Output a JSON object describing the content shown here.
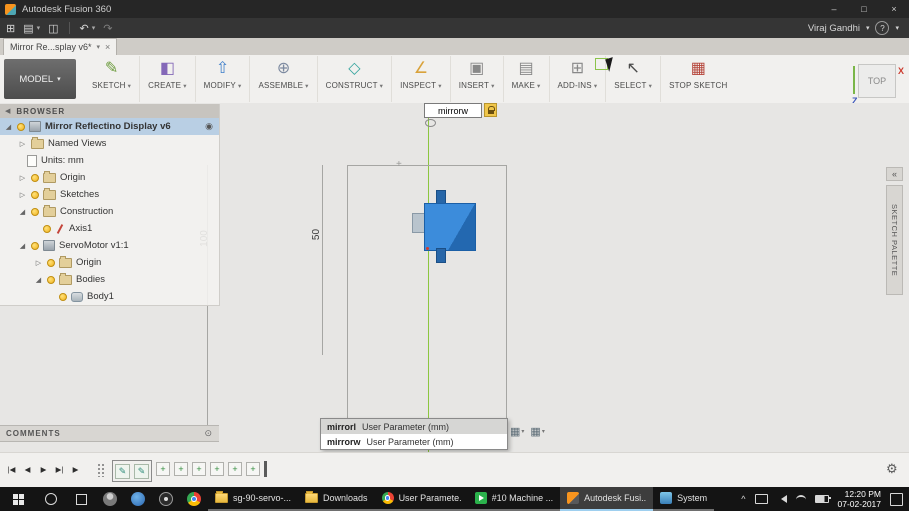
{
  "window": {
    "title": "Autodesk Fusion 360"
  },
  "appbar": {
    "user": "Viraj Gandhi"
  },
  "tab": {
    "label": "Mirror Re...splay v6*"
  },
  "icons": {
    "menu_grid": "⊞",
    "file": "▤",
    "save": "◫",
    "undo": "↶",
    "redo": "↷",
    "caret": "▾",
    "help": "?",
    "min": "–",
    "max": "□",
    "close": "×",
    "tri_open": "◢",
    "tri_closed": "▷",
    "radio": "◉",
    "target": "⊙",
    "collapse_left": "◀",
    "gear": "⚙",
    "grid_snap": "▦",
    "pencil": "✎",
    "plus": "+",
    "cross": "+",
    "caret_up": "^"
  },
  "ribbon": {
    "model": {
      "label": "MODEL"
    },
    "items": [
      {
        "label": "SKETCH",
        "glyph": "✎"
      },
      {
        "label": "CREATE",
        "glyph": "◧"
      },
      {
        "label": "MODIFY",
        "glyph": "⇧"
      },
      {
        "label": "ASSEMBLE",
        "glyph": "⊕"
      },
      {
        "label": "CONSTRUCT",
        "glyph": "◇"
      },
      {
        "label": "INSPECT",
        "glyph": "∠"
      },
      {
        "label": "INSERT",
        "glyph": "▣"
      },
      {
        "label": "MAKE",
        "glyph": "▤"
      },
      {
        "label": "ADD-INS",
        "glyph": "⊞"
      },
      {
        "label": "SELECT",
        "glyph": "↖"
      },
      {
        "label": "STOP SKETCH",
        "glyph": "▦"
      }
    ]
  },
  "viewcube": {
    "face": "TOP",
    "axis_x": "X",
    "axis_z": "Z"
  },
  "browser": {
    "header": "BROWSER",
    "items": [
      {
        "label": "Mirror Reflectino Display v6"
      },
      {
        "label": "Named Views"
      },
      {
        "label": "Units: mm"
      },
      {
        "label": "Origin"
      },
      {
        "label": "Sketches"
      },
      {
        "label": "Construction"
      },
      {
        "label": "Axis1"
      },
      {
        "label": "ServoMotor v1:1"
      },
      {
        "label": "Origin"
      },
      {
        "label": "Bodies"
      },
      {
        "label": "Body1"
      }
    ]
  },
  "canvas": {
    "dim_input_value": "mirrorw",
    "dimensions": {
      "d100": "100",
      "d50": "50"
    },
    "autocomplete": [
      {
        "name": "mirrorl",
        "desc": "User Parameter (mm)"
      },
      {
        "name": "mirrorw",
        "desc": "User Parameter (mm)"
      }
    ]
  },
  "comments": {
    "label": "COMMENTS"
  },
  "sketch_palette": {
    "label": "SKETCH PALETTE",
    "collapse": "«"
  },
  "timeline": {
    "controls": [
      "|◀",
      "◀",
      "▶",
      "▶|",
      "▶"
    ]
  },
  "taskbar": {
    "apps": [
      {
        "label": "sg-90-servo-..."
      },
      {
        "label": "Downloads"
      },
      {
        "label": "User Paramete..."
      },
      {
        "label": "#10 Machine ..."
      },
      {
        "label": "Autodesk Fusi..."
      },
      {
        "label": "System"
      }
    ],
    "clock": {
      "time": "12:20 PM",
      "date": "07-02-2017"
    }
  },
  "colors": {
    "accent_blue": "#2e7fd0",
    "axis_green": "#8cc63f",
    "selection": "#b9cfe4"
  }
}
